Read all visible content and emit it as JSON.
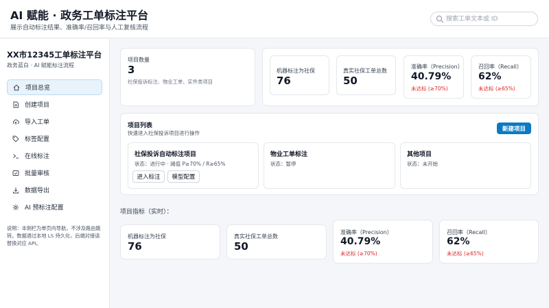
{
  "header": {
    "title": "AI 赋能 · 政务工单标注平台",
    "subtitle": "展示自动标注结果、准确率/召回率与人工复核流程",
    "search_placeholder": "搜索工单文本或 ID",
    "search_icon": "search-icon"
  },
  "sidebar": {
    "title": "XX市12345工单标注平台",
    "subtitle": "政务蓝白 · AI 赋能标注流程",
    "items": [
      {
        "label": "项目总览",
        "icon": "home-icon",
        "active": true
      },
      {
        "label": "创建项目",
        "icon": "file-plus-icon",
        "active": false
      },
      {
        "label": "导入工单",
        "icon": "cloud-upload-icon",
        "active": false
      },
      {
        "label": "标签配置",
        "icon": "tag-icon",
        "active": false
      },
      {
        "label": "在线标注",
        "icon": "terminal-icon",
        "active": false
      },
      {
        "label": "批量审核",
        "icon": "inbox-check-icon",
        "active": false
      },
      {
        "label": "数据导出",
        "icon": "download-icon",
        "active": false
      },
      {
        "label": "AI 预标注配置",
        "icon": "gear-icon",
        "active": false
      }
    ],
    "note": "说明：本侧栏为单页内导航，不涉及路由跳转。数据通过本地 LS 持久化，后端对接请替换对应 API。"
  },
  "summary": {
    "project_count_label": "项目数量",
    "project_count_value": "3",
    "project_count_desc": "社保投诉标注、物业工单、实件类项目"
  },
  "metrics_top": [
    {
      "label": "机器标注为社保",
      "value": "76",
      "warn": ""
    },
    {
      "label": "真实社保工单总数",
      "value": "50",
      "warn": ""
    },
    {
      "label": "准确率（Precision）",
      "value": "40.79%",
      "warn": "未达标 (≥70%)"
    },
    {
      "label": "召回率（Recall）",
      "value": "62%",
      "warn": "未达标 (≥65%)"
    }
  ],
  "project_list": {
    "title": "项目列表",
    "subtitle": "快速进入社保投诉项目进行操作",
    "new_button": "新建项目",
    "projects": [
      {
        "name": "社保投诉自动标注项目",
        "status": "状态：进行中 · 阈值 P≥70% / R≥65%",
        "actions": [
          "进入标注",
          "模型配置"
        ]
      },
      {
        "name": "物业工单标注",
        "status": "状态：暂停",
        "actions": []
      },
      {
        "name": "其他项目",
        "status": "状态：未开始",
        "actions": []
      }
    ]
  },
  "project_metrics": {
    "section_label": "项目指标（实时）：",
    "cards": [
      {
        "label": "机器标注为社保",
        "value": "76",
        "warn": ""
      },
      {
        "label": "真实社保工单总数",
        "value": "50",
        "warn": ""
      },
      {
        "label": "准确率（Precision）",
        "value": "40.79%",
        "warn": "未达标 (≥70%)"
      },
      {
        "label": "召回率（Recall）",
        "value": "62%",
        "warn": "未达标 (≥65%)"
      }
    ]
  },
  "colors": {
    "accent": "#0a7ac2",
    "warning": "#dc2626",
    "active_nav_bg": "#e8f3fb",
    "page_bg": "#f4f6f9"
  }
}
